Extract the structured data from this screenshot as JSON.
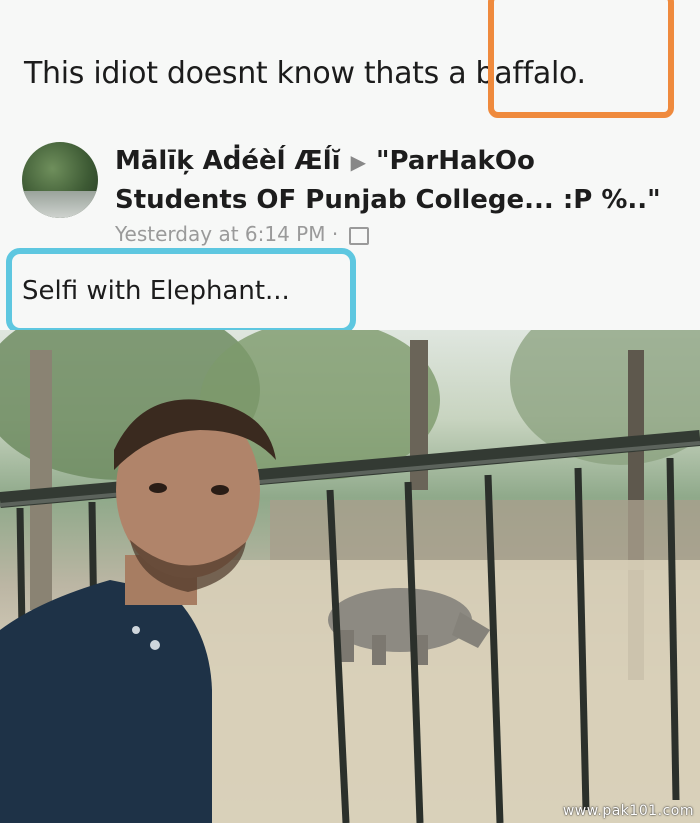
{
  "caption": {
    "text": "This idiot doesnt know thats a baffalo.",
    "highlight_color": "#ef8a3d"
  },
  "post": {
    "author": "Mālīķ Aḋéèĺ Æĺĭ",
    "arrow_icon": "triangle-right-icon",
    "group": "\"ParHakOo Students OF Punjab College... :P %..\"",
    "timestamp": "Yesterday at 6:14 PM",
    "privacy_icon": "group-privacy-icon",
    "text": "Selfi with Elephant...",
    "text_highlight_color": "#5ec7e0"
  },
  "photo": {
    "description_icon": "selfie-photo"
  },
  "watermark": "www.pak101.com"
}
